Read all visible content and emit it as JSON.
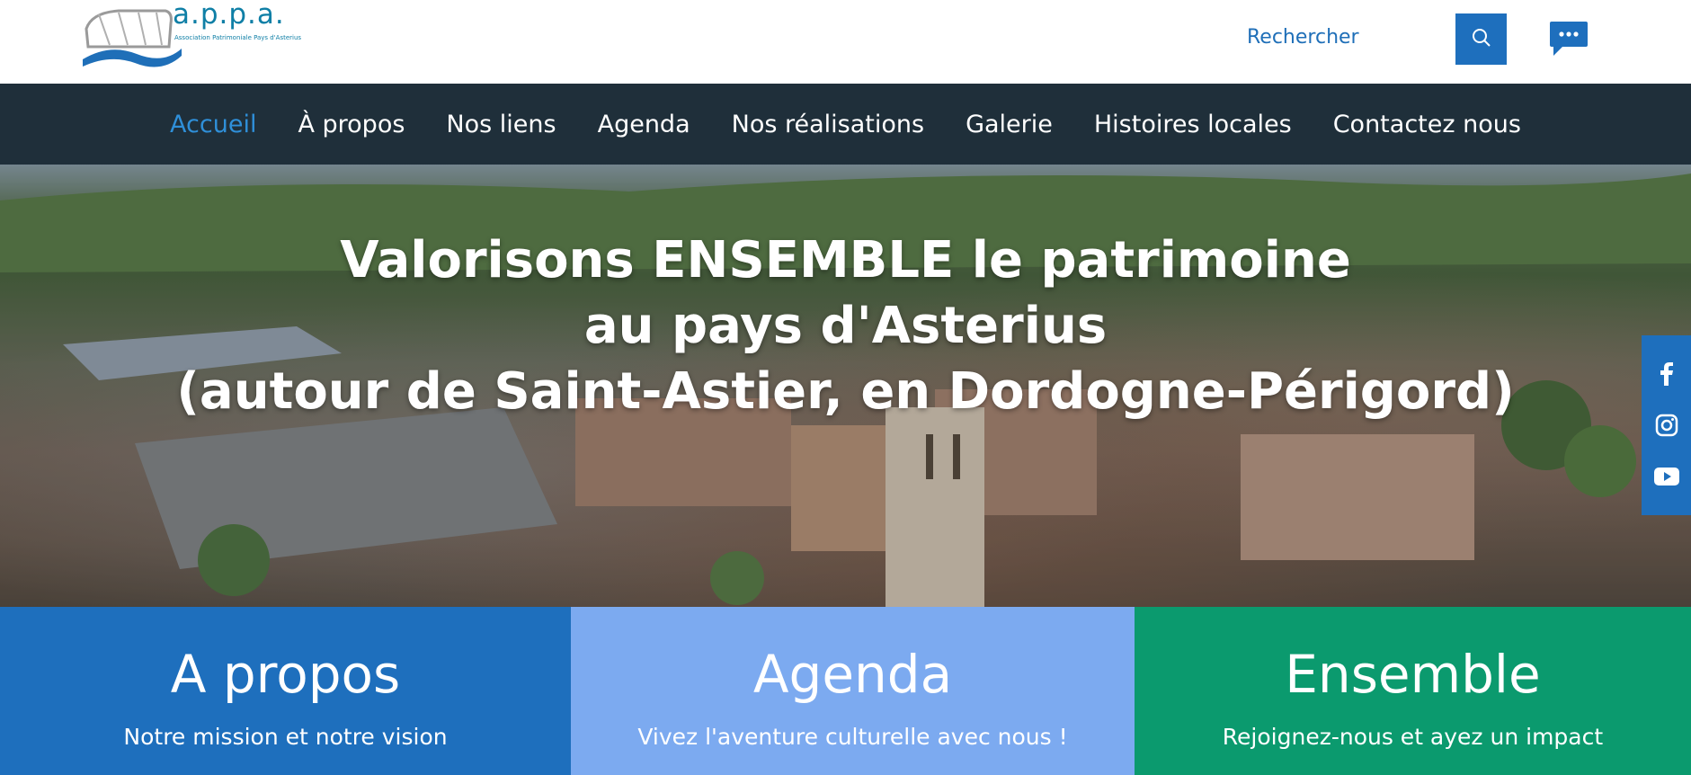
{
  "header": {
    "logo_text": "a.p.p.a.",
    "logo_subtitle": "Association Patrimoniale Pays d'Asterius",
    "search_label": "Rechercher",
    "search_icon": "search-icon",
    "chat_icon": "chat-bubble-icon"
  },
  "nav": {
    "items": [
      {
        "label": "Accueil",
        "active": true
      },
      {
        "label": "À propos"
      },
      {
        "label": "Nos liens"
      },
      {
        "label": "Agenda"
      },
      {
        "label": "Nos réalisations"
      },
      {
        "label": "Galerie"
      },
      {
        "label": "Histoires locales"
      },
      {
        "label": "Contactez nous"
      }
    ],
    "active_color": "#2f8fd8"
  },
  "hero": {
    "line1": "Valorisons ENSEMBLE le patrimoine",
    "line2": "au pays d'Asterius",
    "line3": "(autour de Saint-Astier, en Dordogne-Périgord)"
  },
  "social": {
    "icons": [
      "facebook-icon",
      "instagram-icon",
      "youtube-icon"
    ],
    "color": "#1e6fbd"
  },
  "tiles": [
    {
      "title": "A propos",
      "subtitle": "Notre mission et notre vision",
      "color": "#1e6fbd"
    },
    {
      "title": "Agenda",
      "subtitle": "Vivez l'aventure culturelle avec nous !",
      "color": "#7caaf0"
    },
    {
      "title": "Ensemble",
      "subtitle": "Rejoignez-nous et ayez un impact",
      "color": "#0b9a6e"
    }
  ]
}
